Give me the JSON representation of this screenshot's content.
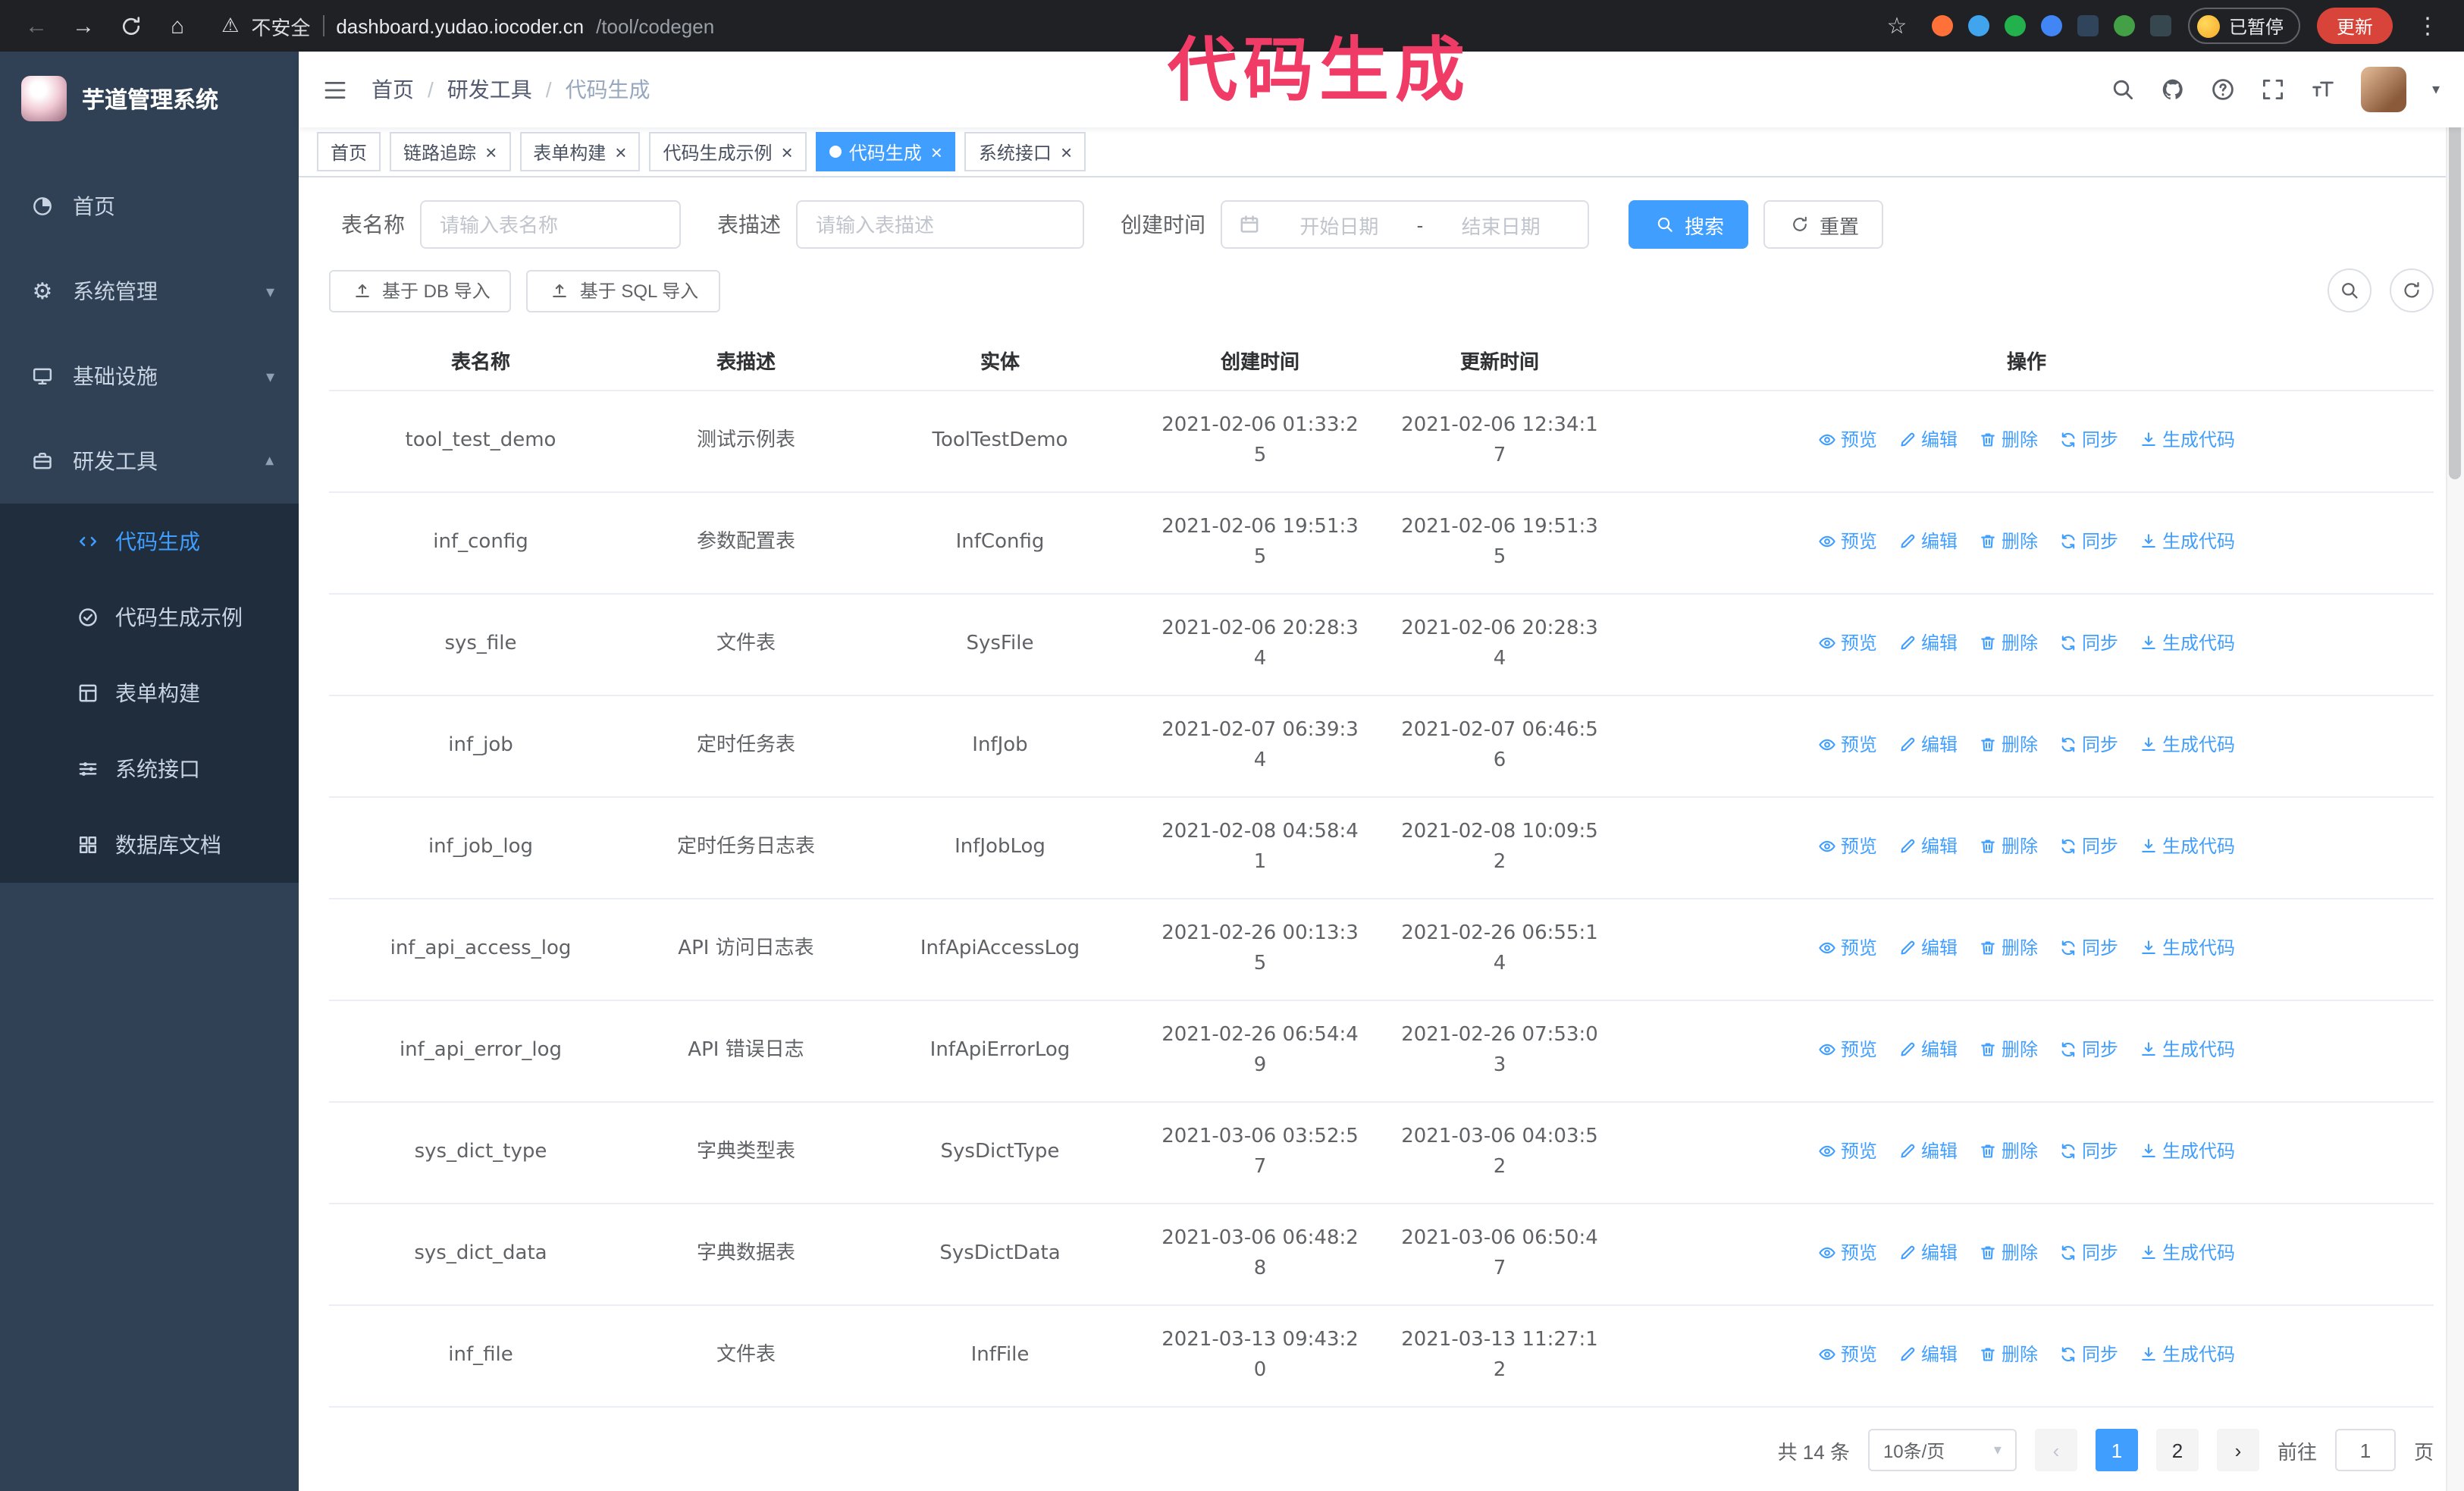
{
  "browser": {
    "security_label": "不安全",
    "url_host": "dashboard.yudao.iocoder.cn",
    "url_path": "/tool/codegen",
    "paused_badge": "已暂停",
    "update_button": "更新",
    "extension_colors": [
      "#ff7139",
      "#41a5ee",
      "#23b14d",
      "#4285f4",
      "#30445c",
      "#43a047",
      "#37474f"
    ]
  },
  "annotation": {
    "text": "代码生成"
  },
  "glyphs": {
    "back": "←",
    "forward": "→",
    "home": "⌂",
    "star": "☆",
    "warning": "⚠",
    "kebab": "⋮",
    "caret": "▾",
    "prev": "‹",
    "next": "›",
    "close": "×"
  },
  "sidebar": {
    "logo_title": "芋道管理系统",
    "items": [
      {
        "id": "home",
        "label": "首页",
        "icon": "home-icon",
        "expandable": false,
        "expanded": false
      },
      {
        "id": "system-mgmt",
        "label": "系统管理",
        "icon": "gear-icon",
        "expandable": true,
        "expanded": false
      },
      {
        "id": "infrastructure",
        "label": "基础设施",
        "icon": "infra-icon",
        "expandable": true,
        "expanded": false
      },
      {
        "id": "dev-tools",
        "label": "研发工具",
        "icon": "tools-icon",
        "expandable": true,
        "expanded": true
      }
    ],
    "subitems": [
      {
        "id": "codegen",
        "label": "代码生成",
        "icon": "code-icon",
        "active": true
      },
      {
        "id": "codegen-example",
        "label": "代码生成示例",
        "icon": "example-icon",
        "active": false
      },
      {
        "id": "form-builder",
        "label": "表单构建",
        "icon": "form-icon",
        "active": false
      },
      {
        "id": "system-api",
        "label": "系统接口",
        "icon": "api-icon",
        "active": false
      },
      {
        "id": "db-doc",
        "label": "数据库文档",
        "icon": "database-icon",
        "active": false
      }
    ]
  },
  "navbar": {
    "breadcrumb": [
      "首页",
      "研发工具",
      "代码生成"
    ]
  },
  "tabs": [
    {
      "id": "home",
      "label": "首页",
      "closable": false,
      "active": false
    },
    {
      "id": "tracer",
      "label": "链路追踪",
      "closable": true,
      "active": false
    },
    {
      "id": "form-builder",
      "label": "表单构建",
      "closable": true,
      "active": false
    },
    {
      "id": "codegen-example",
      "label": "代码生成示例",
      "closable": true,
      "active": false
    },
    {
      "id": "codegen",
      "label": "代码生成",
      "closable": true,
      "active": true
    },
    {
      "id": "system-api",
      "label": "系统接口",
      "closable": true,
      "active": false
    }
  ],
  "filters": {
    "table_name_label": "表名称",
    "table_name_placeholder": "请输入表名称",
    "table_desc_label": "表描述",
    "table_desc_placeholder": "请输入表描述",
    "create_time_label": "创建时间",
    "date_start_placeholder": "开始日期",
    "date_separator": "-",
    "date_end_placeholder": "结束日期",
    "search_button": "搜索",
    "reset_button": "重置"
  },
  "toolbar": {
    "import_db": "基于 DB 导入",
    "import_sql": "基于 SQL 导入"
  },
  "table": {
    "columns": [
      "表名称",
      "表描述",
      "实体",
      "创建时间",
      "更新时间",
      "操作"
    ],
    "actions": [
      "预览",
      "编辑",
      "删除",
      "同步",
      "生成代码"
    ],
    "rows": [
      {
        "name": "tool_test_demo",
        "desc": "测试示例表",
        "entity": "ToolTestDemo",
        "created": "2021-02-06 01:33:25",
        "updated": "2021-02-06 12:34:17"
      },
      {
        "name": "inf_config",
        "desc": "参数配置表",
        "entity": "InfConfig",
        "created": "2021-02-06 19:51:35",
        "updated": "2021-02-06 19:51:35"
      },
      {
        "name": "sys_file",
        "desc": "文件表",
        "entity": "SysFile",
        "created": "2021-02-06 20:28:34",
        "updated": "2021-02-06 20:28:34"
      },
      {
        "name": "inf_job",
        "desc": "定时任务表",
        "entity": "InfJob",
        "created": "2021-02-07 06:39:34",
        "updated": "2021-02-07 06:46:56"
      },
      {
        "name": "inf_job_log",
        "desc": "定时任务日志表",
        "entity": "InfJobLog",
        "created": "2021-02-08 04:58:41",
        "updated": "2021-02-08 10:09:52"
      },
      {
        "name": "inf_api_access_log",
        "desc": "API 访问日志表",
        "entity": "InfApiAccessLog",
        "created": "2021-02-26 00:13:35",
        "updated": "2021-02-26 06:55:14"
      },
      {
        "name": "inf_api_error_log",
        "desc": "API 错误日志",
        "entity": "InfApiErrorLog",
        "created": "2021-02-26 06:54:49",
        "updated": "2021-02-26 07:53:03"
      },
      {
        "name": "sys_dict_type",
        "desc": "字典类型表",
        "entity": "SysDictType",
        "created": "2021-03-06 03:52:57",
        "updated": "2021-03-06 04:03:52"
      },
      {
        "name": "sys_dict_data",
        "desc": "字典数据表",
        "entity": "SysDictData",
        "created": "2021-03-06 06:48:28",
        "updated": "2021-03-06 06:50:47"
      },
      {
        "name": "inf_file",
        "desc": "文件表",
        "entity": "InfFile",
        "created": "2021-03-13 09:43:20",
        "updated": "2021-03-13 11:27:12"
      }
    ]
  },
  "pagination": {
    "total": "共 14 条",
    "page_size": "10条/页",
    "pages": [
      "1",
      "2"
    ],
    "active_page": "1",
    "goto_label": "前往",
    "goto_value": "1",
    "page_suffix": "页"
  }
}
